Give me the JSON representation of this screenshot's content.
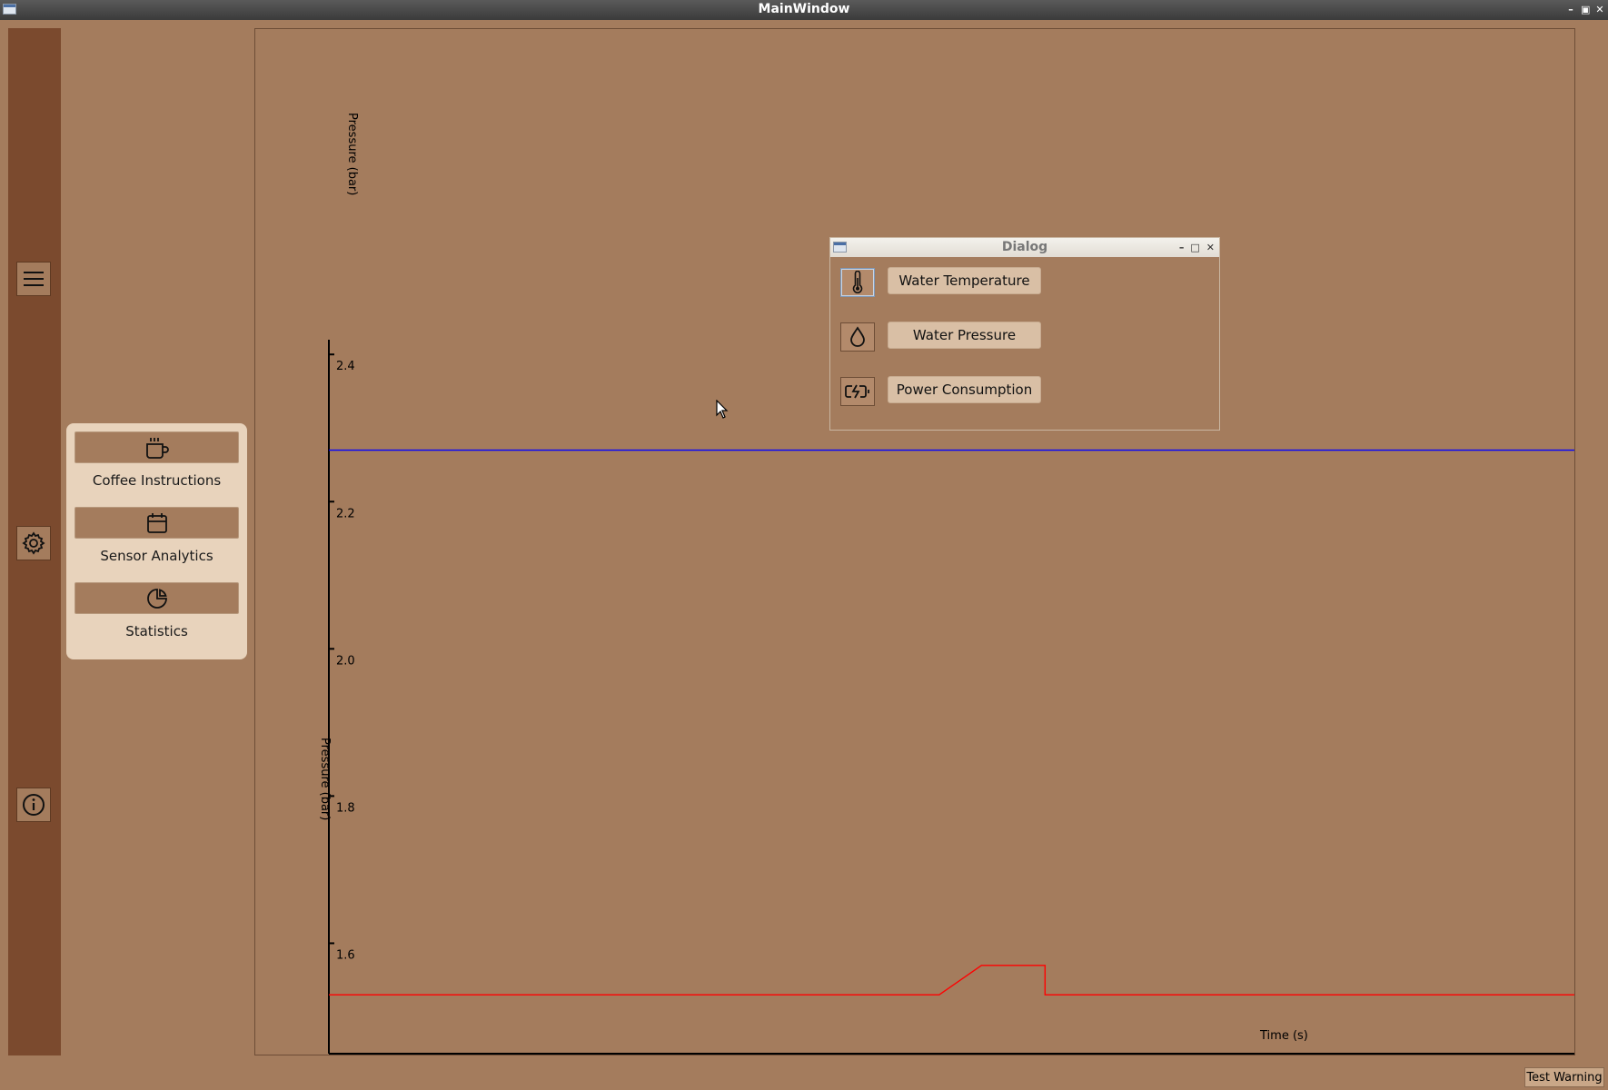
{
  "window": {
    "title": "MainWindow"
  },
  "rail": {
    "items": [
      "hamburger-icon",
      "gear-icon",
      "info-icon"
    ]
  },
  "menu": {
    "items": [
      {
        "label": "Coffee Instructions",
        "icon": "coffee-cup-icon"
      },
      {
        "label": "Sensor Analytics",
        "icon": "calendar-icon"
      },
      {
        "label": "Statistics",
        "icon": "pie-chart-icon"
      }
    ]
  },
  "plot": {
    "top_label": "Pressure (bar)",
    "overlap_label": "Pressure (bar)",
    "xlabel": "Time (s)"
  },
  "chart_data": {
    "type": "line",
    "ylabel": "Pressure (bar)",
    "xlabel": "Time (s)",
    "y_ticks": [
      "2.4",
      "2.2",
      "2.0",
      "1.8",
      "1.6"
    ],
    "ylim": [
      1.45,
      2.42
    ],
    "xlim": [
      0,
      100
    ],
    "series": [
      {
        "color": "#0000ff",
        "x": [
          0,
          100
        ],
        "y": [
          2.27,
          2.27
        ]
      },
      {
        "color": "#ff0000",
        "x": [
          0,
          49,
          52.4,
          57.5,
          57.5,
          100
        ],
        "y": [
          1.53,
          1.53,
          1.57,
          1.57,
          1.53,
          1.53
        ]
      }
    ]
  },
  "dialog": {
    "title": "Dialog",
    "buttons": [
      {
        "label": "Water Temperature",
        "icon": "thermometer-icon"
      },
      {
        "label": "Water Pressure",
        "icon": "droplet-icon"
      },
      {
        "label": "Power Consumption",
        "icon": "battery-charging-icon"
      }
    ]
  },
  "footer": {
    "test_warning": "Test Warning"
  }
}
